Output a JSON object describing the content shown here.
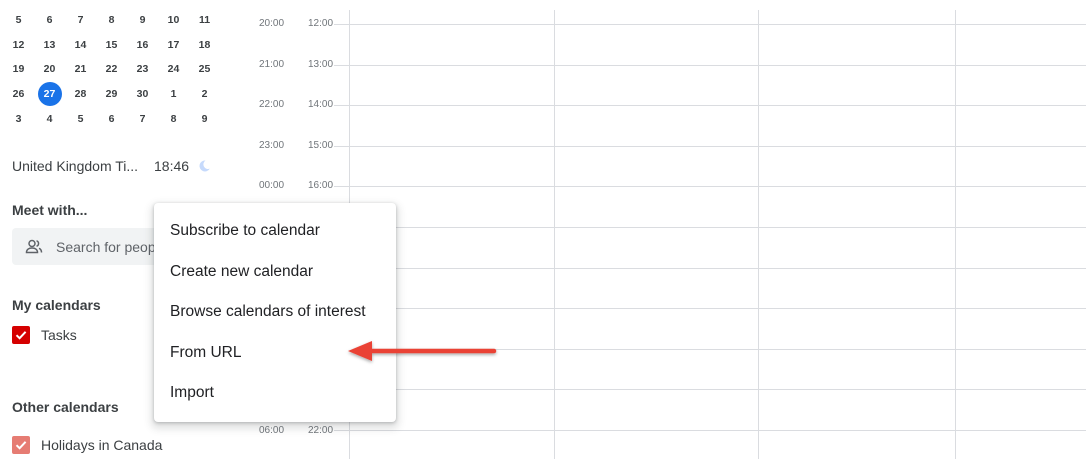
{
  "mini_calendar": {
    "weeks": [
      [
        "5",
        "6",
        "7",
        "8",
        "9",
        "10",
        "11"
      ],
      [
        "12",
        "13",
        "14",
        "15",
        "16",
        "17",
        "18"
      ],
      [
        "19",
        "20",
        "21",
        "22",
        "23",
        "24",
        "25"
      ],
      [
        "26",
        "27",
        "28",
        "29",
        "30",
        "1",
        "2"
      ],
      [
        "3",
        "4",
        "5",
        "6",
        "7",
        "8",
        "9"
      ]
    ],
    "today": "27",
    "accent_color": "#1a73e8"
  },
  "timezone": {
    "name": "United Kingdom Ti...",
    "time": "18:46",
    "icon": "moon-icon"
  },
  "meet_with": {
    "title": "Meet with...",
    "search_placeholder": "Search for people",
    "icon": "people-icon"
  },
  "my_calendars": {
    "title": "My calendars",
    "items": [
      {
        "label": "Tasks",
        "color": "#d50000",
        "checked": true
      }
    ]
  },
  "other_calendars": {
    "title": "Other calendars",
    "items": [
      {
        "label": "Holidays in Canada",
        "color": "#e67c73",
        "checked": true
      }
    ]
  },
  "time_labels": {
    "primary": [
      "20:00",
      "21:00",
      "22:00",
      "23:00",
      "00:00",
      "06:00"
    ],
    "secondary": [
      "12:00",
      "13:00",
      "14:00",
      "15:00",
      "16:00",
      "22:00"
    ]
  },
  "context_menu": {
    "items": [
      "Subscribe to calendar",
      "Create new calendar",
      "Browse calendars of interest",
      "From URL",
      "Import"
    ]
  },
  "annotation": {
    "arrow_color": "#ea4335",
    "points_to": "From URL"
  }
}
